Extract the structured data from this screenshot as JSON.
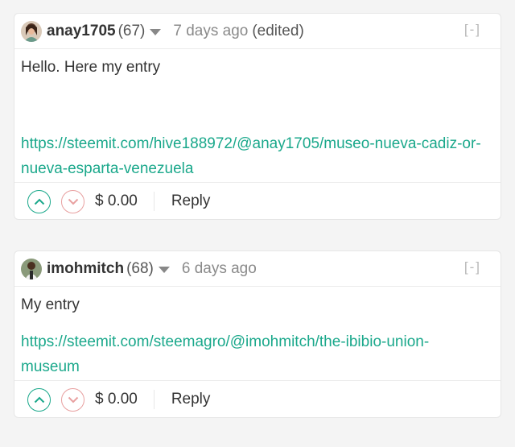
{
  "comments": [
    {
      "author": "anay1705",
      "reputation": "(67)",
      "time": "7 days ago",
      "edited": "(edited)",
      "collapse": "[-]",
      "text": "Hello. Here my entry",
      "link": "https://steemit.com/hive188972/@anay1705/museo-nueva-cadiz-or-nueva-esparta-venezuela",
      "payout": "$ 0.00",
      "reply": "Reply"
    },
    {
      "author": "imohmitch",
      "reputation": "(68)",
      "time": "6 days ago",
      "collapse": "[-]",
      "text": "My entry",
      "link": "https://steemit.com/steemagro/@imohmitch/the-ibibio-union-museum",
      "payout": "$ 0.00",
      "reply": "Reply"
    }
  ],
  "colors": {
    "link": "#1aa88b",
    "upvote": "#1aa88b",
    "downvote": "#e8a0a0",
    "background": "#f4f4f4"
  },
  "icons": [
    "avatar-anay1705",
    "avatar-imohmitch",
    "caret-down-icon",
    "upvote-icon",
    "downvote-icon"
  ]
}
